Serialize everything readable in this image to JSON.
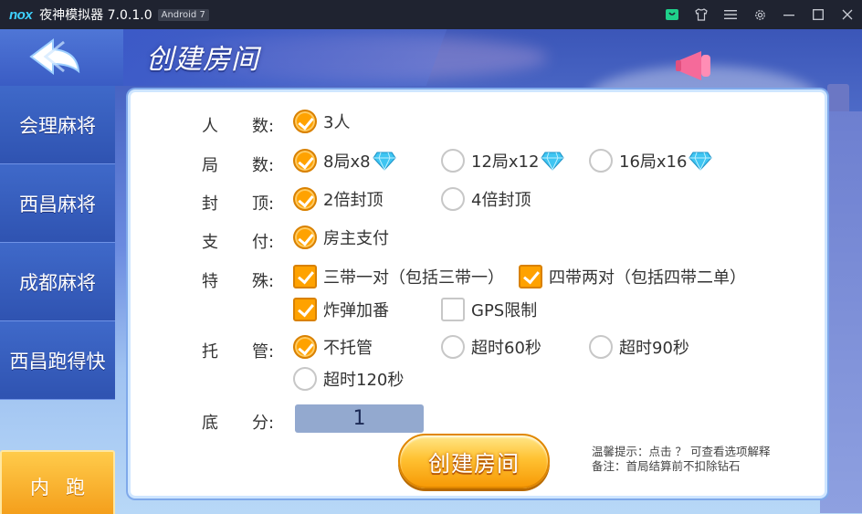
{
  "titlebar": {
    "logo": "nox",
    "title": "夜神模拟器 7.0.1.0",
    "android_badge": "Android 7",
    "icons": [
      "store-icon",
      "shirt-icon",
      "menu-icon",
      "gear-icon",
      "minimize-icon",
      "maximize-icon",
      "close-icon"
    ]
  },
  "header": {
    "title": "创建房间",
    "back_icon": "back-arrow-icon"
  },
  "sidebar": {
    "items": [
      {
        "label": "会理麻将"
      },
      {
        "label": "西昌麻将"
      },
      {
        "label": "成都麻将"
      },
      {
        "label": "西昌跑得快"
      },
      {
        "label": "内跑"
      }
    ],
    "active_index": 4
  },
  "form": {
    "players": {
      "label": [
        "人",
        "数:"
      ],
      "options": [
        {
          "label": "3人",
          "checked": true
        }
      ]
    },
    "rounds": {
      "label": [
        "局",
        "数:"
      ],
      "options": [
        {
          "label": "8局x8",
          "checked": true,
          "icon": "diamond-icon"
        },
        {
          "label": "12局x12",
          "checked": false,
          "icon": "diamond-icon"
        },
        {
          "label": "16局x16",
          "checked": false,
          "icon": "diamond-icon"
        }
      ]
    },
    "cap": {
      "label": [
        "封",
        "顶:"
      ],
      "options": [
        {
          "label": "2倍封顶",
          "checked": true
        },
        {
          "label": "4倍封顶",
          "checked": false
        }
      ]
    },
    "payment": {
      "label": [
        "支",
        "付:"
      ],
      "options": [
        {
          "label": "房主支付",
          "checked": true
        }
      ]
    },
    "special": {
      "label": [
        "特",
        "殊:"
      ],
      "options": [
        {
          "label": "三带一对（包括三带一）",
          "checked": true
        },
        {
          "label": "四带两对（包括四带二单）",
          "checked": true
        },
        {
          "label": "炸弹加番",
          "checked": true
        },
        {
          "label": "GPS限制",
          "checked": false
        }
      ]
    },
    "hosting": {
      "label": [
        "托",
        "管:"
      ],
      "options": [
        {
          "label": "不托管",
          "checked": true
        },
        {
          "label": "超时60秒",
          "checked": false
        },
        {
          "label": "超时90秒",
          "checked": false
        },
        {
          "label": "超时120秒",
          "checked": false
        }
      ]
    },
    "base_score": {
      "label": [
        "底",
        "分:"
      ],
      "value": "1"
    }
  },
  "create_button": {
    "label": "创建房间"
  },
  "hint": {
    "line1": "温馨提示：点击 ？ 可查看选项解释",
    "line2": "备注：首局结算前不扣除钻石"
  },
  "colors": {
    "accent_orange": "#ffa200",
    "sidebar_blue": "#3f69c9",
    "active_tab": "#f39a16",
    "score_box": "#93a9cf"
  }
}
